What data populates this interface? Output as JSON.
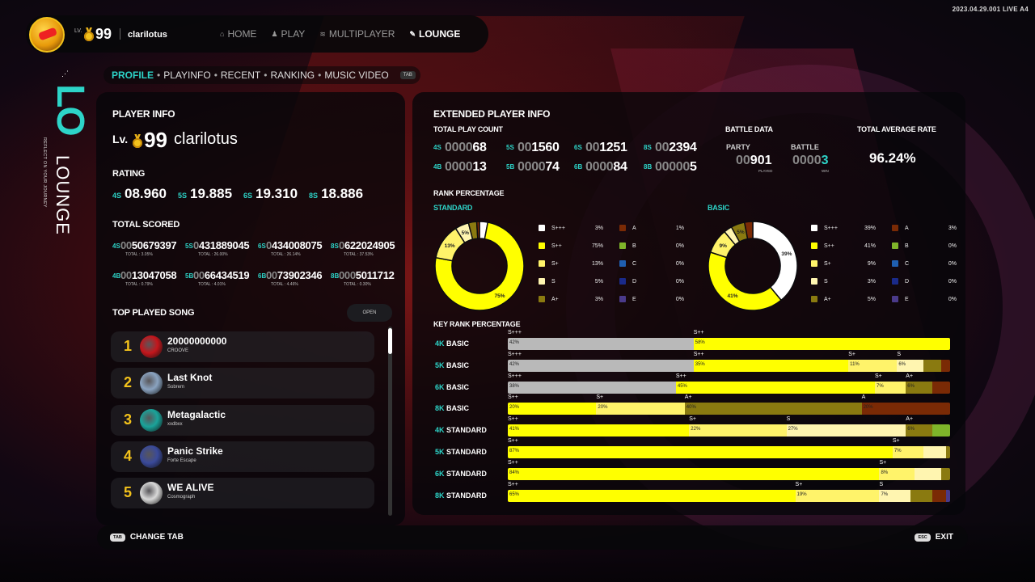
{
  "version": "2023.04.29.001 LIVE A4",
  "topbar": {
    "lv_small": "LV.",
    "level": "99",
    "username": "clarilotus",
    "nav": [
      {
        "label": "HOME",
        "icon": "home-icon",
        "glyph": "⌂",
        "active": false
      },
      {
        "label": "PLAY",
        "icon": "player-icon",
        "glyph": "♟",
        "active": false
      },
      {
        "label": "MULTIPLAYER",
        "icon": "signal-icon",
        "glyph": "≋",
        "active": false
      },
      {
        "label": "LOUNGE",
        "icon": "wrench-icon",
        "glyph": "✎",
        "active": true
      }
    ]
  },
  "sidelogo": {
    "lo": "LO",
    "lounge": "LOUNGE",
    "tagline": "REFLECT ON YOUR JOURNEY"
  },
  "tabs": {
    "items": [
      "PROFILE",
      "PLAYINFO",
      "RECENT",
      "RANKING",
      "MUSIC VIDEO"
    ],
    "active": 0,
    "key": "TAB"
  },
  "player_info": {
    "heading": "PLAYER INFO",
    "lv_label": "Lv.",
    "level": "99",
    "name": "clarilotus",
    "rating_heading": "RATING",
    "rating": [
      {
        "k": "4S",
        "v": "08.960"
      },
      {
        "k": "5S",
        "v": "19.885"
      },
      {
        "k": "6S",
        "v": "19.310"
      },
      {
        "k": "8S",
        "v": "18.886"
      }
    ],
    "scored_heading": "TOTAL SCORED",
    "scored": [
      [
        {
          "k": "4S",
          "v": "0050679397",
          "t": "TOTAL : 3.05%"
        },
        {
          "k": "5S",
          "v": "0431889045",
          "t": "TOTAL : 26.00%"
        },
        {
          "k": "6S",
          "v": "0434008075",
          "t": "TOTAL : 26.14%"
        },
        {
          "k": "8S",
          "v": "0622024905",
          "t": "TOTAL : 37.53%"
        }
      ],
      [
        {
          "k": "4B",
          "v": "0013047058",
          "t": "TOTAL : 0.79%"
        },
        {
          "k": "5B",
          "v": "0066434519",
          "t": "TOTAL : 4.01%"
        },
        {
          "k": "6B",
          "v": "0073902346",
          "t": "TOTAL : 4.46%"
        },
        {
          "k": "8B",
          "v": "0005011712",
          "t": "TOTAL : 0.30%"
        }
      ]
    ],
    "top_heading": "TOP PLAYED SONG",
    "open_label": "OPEN",
    "songs": [
      {
        "rank": "1",
        "title": "20000000000",
        "artist": "CROOVE",
        "color": "#c4161c"
      },
      {
        "rank": "2",
        "title": "Last Knot",
        "artist": "Sobrem",
        "color": "#8aa3c0"
      },
      {
        "rank": "3",
        "title": "Metagalactic",
        "artist": "xxdbxx",
        "color": "#1aa39a"
      },
      {
        "rank": "4",
        "title": "Panic Strike",
        "artist": "Forte Escape",
        "color": "#3a4a9a"
      },
      {
        "rank": "5",
        "title": "WE ALIVE",
        "artist": "Cosmograph",
        "color": "#d8d8d8"
      }
    ]
  },
  "extended": {
    "heading": "EXTENDED PLAYER INFO",
    "play_count_heading": "TOTAL PLAY COUNT",
    "play_count": [
      {
        "k": "4S",
        "v": "000068"
      },
      {
        "k": "5S",
        "v": "001560"
      },
      {
        "k": "6S",
        "v": "001251"
      },
      {
        "k": "8S",
        "v": "002394"
      },
      {
        "k": "4B",
        "v": "000013"
      },
      {
        "k": "5B",
        "v": "000074"
      },
      {
        "k": "6B",
        "v": "000084"
      },
      {
        "k": "8B",
        "v": "000005"
      }
    ],
    "battle_heading": "BATTLE DATA",
    "party_label": "PARTY",
    "party_value": "00901",
    "party_sub": "PLAYED",
    "battle_label": "BATTLE",
    "battle_value": "00003",
    "battle_sub": "WIN",
    "avg_heading": "TOTAL AVERAGE RATE",
    "avg_value": "96.24%",
    "rank_pct_heading": "RANK PERCENTAGE",
    "key_rank_heading": "KEY RANK PERCENTAGE"
  },
  "colors": {
    "S+++": "#ffffff",
    "S++": "#ffff00",
    "S+": "#fff36a",
    "S": "#fff5b0",
    "A+": "#8a7a10",
    "A": "#7a2a05",
    "B": "#7fb52a",
    "C": "#1f5fb0",
    "D": "#1a2a8a",
    "E": "#4a3a8a",
    "accent": "#2dd4c8",
    "gold": "#f3c21b"
  },
  "chart_data": [
    {
      "type": "pie",
      "title": "STANDARD",
      "categories": [
        "S+++",
        "S++",
        "S+",
        "S",
        "A+",
        "A",
        "B",
        "C",
        "D",
        "E"
      ],
      "values": [
        3,
        75,
        13,
        5,
        3,
        1,
        0,
        0,
        0,
        0
      ],
      "labels": [
        "3%",
        "75%",
        "13%",
        "5%",
        "3%",
        "1%",
        "0%",
        "0%",
        "0%",
        "0%"
      ],
      "slice_labels": [
        "",
        "75%",
        "13%",
        "5%",
        "",
        "",
        "",
        "",
        "",
        ""
      ]
    },
    {
      "type": "pie",
      "title": "BASIC",
      "categories": [
        "S+++",
        "S++",
        "S+",
        "S",
        "A+",
        "A",
        "B",
        "C",
        "D",
        "E"
      ],
      "values": [
        39,
        41,
        9,
        3,
        5,
        3,
        0,
        0,
        0,
        0
      ],
      "labels": [
        "39%",
        "41%",
        "9%",
        "3%",
        "5%",
        "3%",
        "0%",
        "0%",
        "0%",
        "0%"
      ],
      "slice_labels": [
        "39%",
        "41%",
        "9%",
        "",
        "5%",
        "",
        "",
        "",
        "",
        ""
      ]
    },
    {
      "type": "bar",
      "title": "KEY RANK PERCENTAGE",
      "stacked": true,
      "orientation": "horizontal",
      "categories": [
        "4K BASIC",
        "5K BASIC",
        "6K BASIC",
        "8K BASIC",
        "4K STANDARD",
        "5K STANDARD",
        "6K STANDARD",
        "8K STANDARD"
      ],
      "rows": [
        [
          [
            "S+++",
            42,
            "42%"
          ],
          [
            "S++",
            58,
            "58%"
          ]
        ],
        [
          [
            "S+++",
            42,
            "42%"
          ],
          [
            "S++",
            35,
            "35%"
          ],
          [
            "S+",
            11,
            "11%"
          ],
          [
            "S",
            6,
            "6%"
          ],
          [
            "A+",
            4,
            ""
          ],
          [
            "A",
            2,
            ""
          ]
        ],
        [
          [
            "S+++",
            38,
            "38%"
          ],
          [
            "S++",
            45,
            "45%"
          ],
          [
            "S+",
            7,
            "7%"
          ],
          [
            "A+",
            6,
            "6%"
          ],
          [
            "A",
            4,
            ""
          ]
        ],
        [
          [
            "S++",
            20,
            "20%"
          ],
          [
            "S+",
            20,
            "20%"
          ],
          [
            "A+",
            40,
            "40%"
          ],
          [
            "A",
            20,
            "20%"
          ]
        ],
        [
          [
            "S++",
            41,
            "41%"
          ],
          [
            "S+",
            22,
            "22%"
          ],
          [
            "S",
            27,
            "27%"
          ],
          [
            "A+",
            6,
            "6%"
          ],
          [
            "B",
            4,
            ""
          ]
        ],
        [
          [
            "S++",
            87,
            "87%"
          ],
          [
            "S+",
            7,
            "7%"
          ],
          [
            "S",
            5,
            ""
          ],
          [
            "A+",
            1,
            ""
          ]
        ],
        [
          [
            "S++",
            84,
            "84%"
          ],
          [
            "S+",
            8,
            "8%"
          ],
          [
            "S",
            6,
            ""
          ],
          [
            "A+",
            2,
            ""
          ]
        ],
        [
          [
            "S++",
            65,
            "65%"
          ],
          [
            "S+",
            19,
            "19%"
          ],
          [
            "S",
            7,
            "7%"
          ],
          [
            "A+",
            5,
            ""
          ],
          [
            "A",
            3,
            ""
          ],
          [
            "E",
            1,
            ""
          ]
        ]
      ]
    }
  ],
  "bottom": {
    "tab_key": "TAB",
    "tab_label": "CHANGE TAB",
    "esc_key": "ESC",
    "exit_label": "EXIT"
  }
}
